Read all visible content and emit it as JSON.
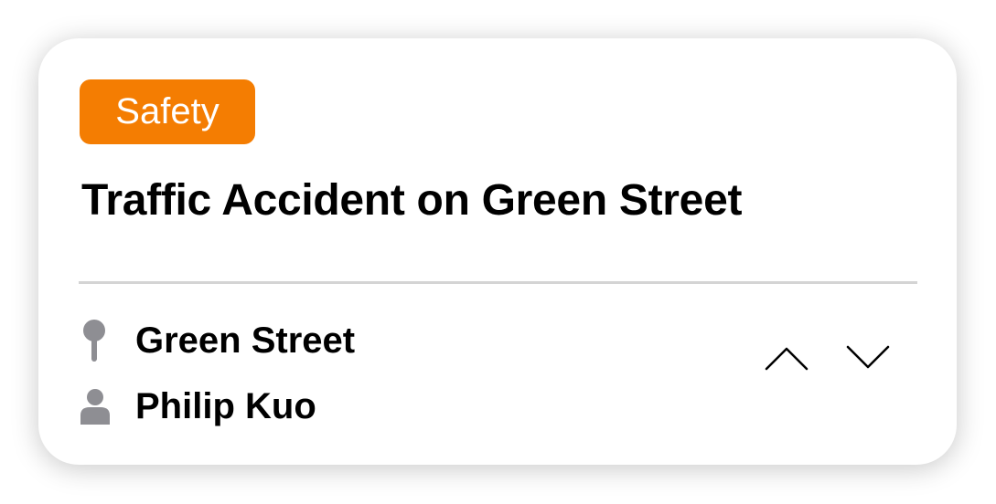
{
  "card": {
    "category": "Safety",
    "category_color": "#F47D02",
    "title": "Traffic Accident on Green Street",
    "location": {
      "icon": "pin-icon",
      "text": "Green Street"
    },
    "author": {
      "icon": "person-icon",
      "text": "Philip Kuo"
    },
    "navigation": {
      "previous_icon": "chevron-up-icon",
      "next_icon": "chevron-down-icon"
    }
  }
}
